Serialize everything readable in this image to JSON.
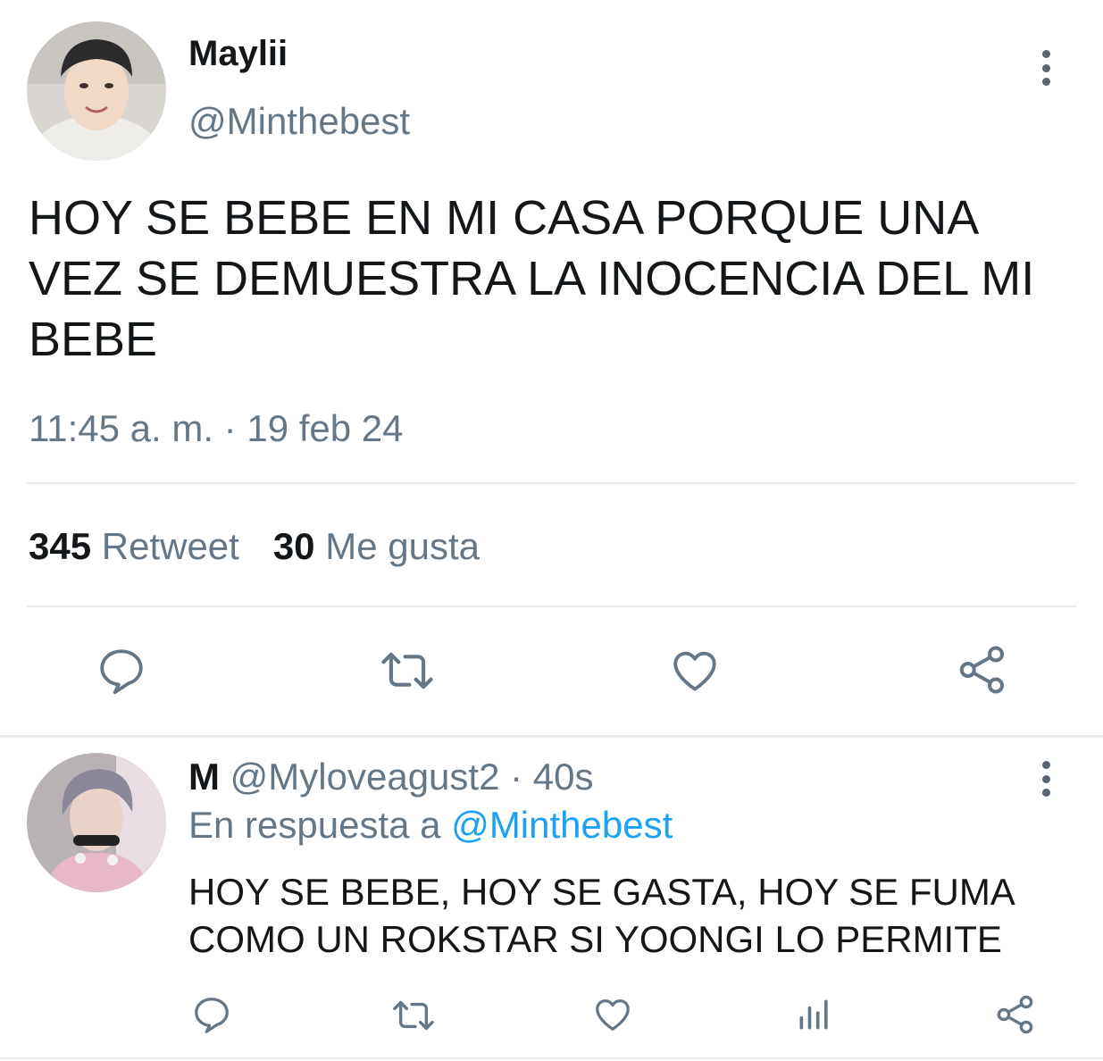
{
  "main_tweet": {
    "author_name": "Maylii",
    "author_handle": "@Minthebest",
    "text": "HOY SE BEBE EN MI CASA PORQUE UNA VEZ SE DEMUESTRA LA INOCENCIA DEL MI BEBE",
    "timestamp": "11:45 a. m. · 19 feb 24",
    "retweets_count": "345",
    "retweets_label": "Retweet",
    "likes_count": "30",
    "likes_label": "Me gusta",
    "actions": [
      "reply-icon",
      "retweet-icon",
      "like-icon",
      "share-icon"
    ]
  },
  "reply_tweet": {
    "author_name": "M",
    "author_handle": "@Myloveagust2",
    "separator": " · ",
    "time_ago": "40s",
    "reply_to_prefix": "En respuesta a ",
    "reply_to_handle": "@Minthebest",
    "text": "HOY SE BEBE, HOY SE GASTA, HOY SE FUMA COMO UN ROKSTAR SI YOONGI LO PERMITE",
    "actions": [
      "reply-icon",
      "retweet-icon",
      "like-icon",
      "analytics-icon",
      "share-icon"
    ]
  },
  "colors": {
    "text_primary": "#14171a",
    "text_secondary": "#657786",
    "link": "#1da1f2",
    "divider": "#e6ecf0",
    "icon": "#657786"
  }
}
